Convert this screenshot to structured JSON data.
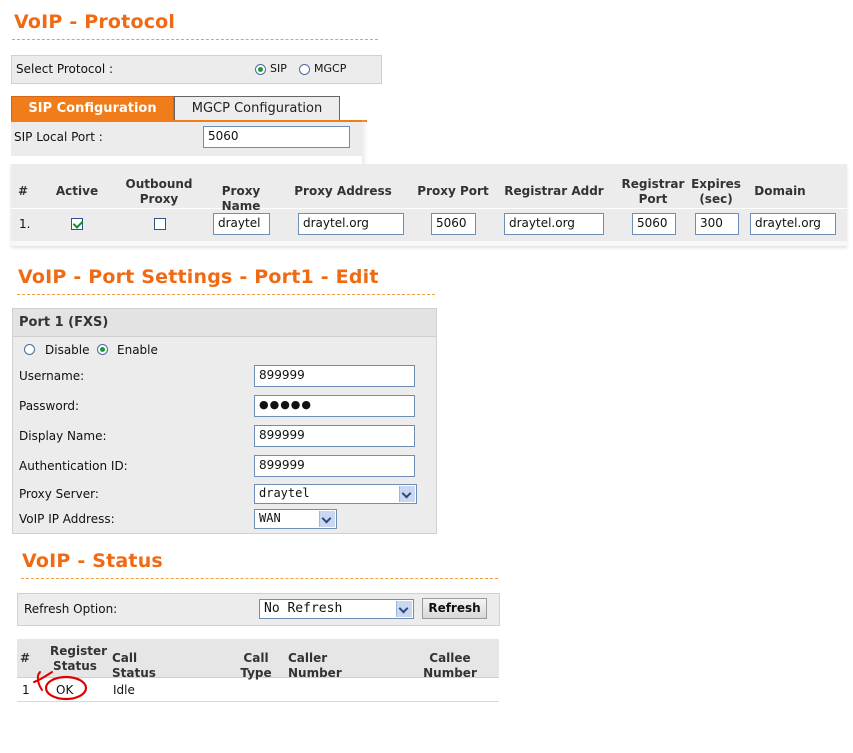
{
  "protocol": {
    "title": "VoIP - Protocol",
    "select_label": "Select Protocol :",
    "options": [
      "SIP",
      "MGCP"
    ],
    "selected": "SIP",
    "tabs": [
      "SIP Configuration",
      "MGCP Configuration"
    ],
    "local_port_label": "SIP Local Port :",
    "local_port": "5060",
    "columns": {
      "num": "#",
      "active": "Active",
      "outbound": "Outbound Proxy",
      "proxy_name": "Proxy Name",
      "proxy_address": "Proxy Address",
      "proxy_port": "Proxy Port",
      "registrar_addr": "Registrar Addr",
      "registrar_port": "Registrar Port",
      "expires": "Expires (sec)",
      "domain": "Domain"
    },
    "rows": [
      {
        "num": "1.",
        "active": true,
        "outbound": false,
        "proxy_name": "draytel",
        "proxy_address": "draytel.org",
        "proxy_port": "5060",
        "registrar_addr": "draytel.org",
        "registrar_port": "5060",
        "expires": "300",
        "domain": "draytel.org"
      }
    ]
  },
  "port": {
    "title": "VoIP - Port Settings - Port1 - Edit",
    "header": "Port 1 (FXS)",
    "mode_options": [
      "Disable",
      "Enable"
    ],
    "mode_selected": "Enable",
    "username_label": "Username:",
    "username": "899999",
    "password_label": "Password:",
    "password_mask": "●●●●●",
    "display_name_label": "Display Name:",
    "display_name": "899999",
    "auth_id_label": "Authentication ID:",
    "auth_id": "899999",
    "proxy_server_label": "Proxy Server:",
    "proxy_server": "draytel",
    "voip_ip_label": "VoIP IP Address:",
    "voip_ip": "WAN"
  },
  "status": {
    "title": "VoIP - Status",
    "refresh_label": "Refresh Option:",
    "refresh_value": "No Refresh",
    "refresh_button": "Refresh",
    "columns": {
      "num": "#",
      "register": "Register Status",
      "call_status": "Call Status",
      "call_type": "Call Type",
      "caller": "Caller Number",
      "callee": "Callee Number"
    },
    "rows": [
      {
        "num": "1",
        "register": "OK",
        "call_status": "Idle",
        "call_type": "",
        "caller": "",
        "callee": ""
      }
    ]
  },
  "colors": {
    "accent": "#f06a14",
    "tab_active": "#f07c1a",
    "annotation": "#e00000"
  }
}
